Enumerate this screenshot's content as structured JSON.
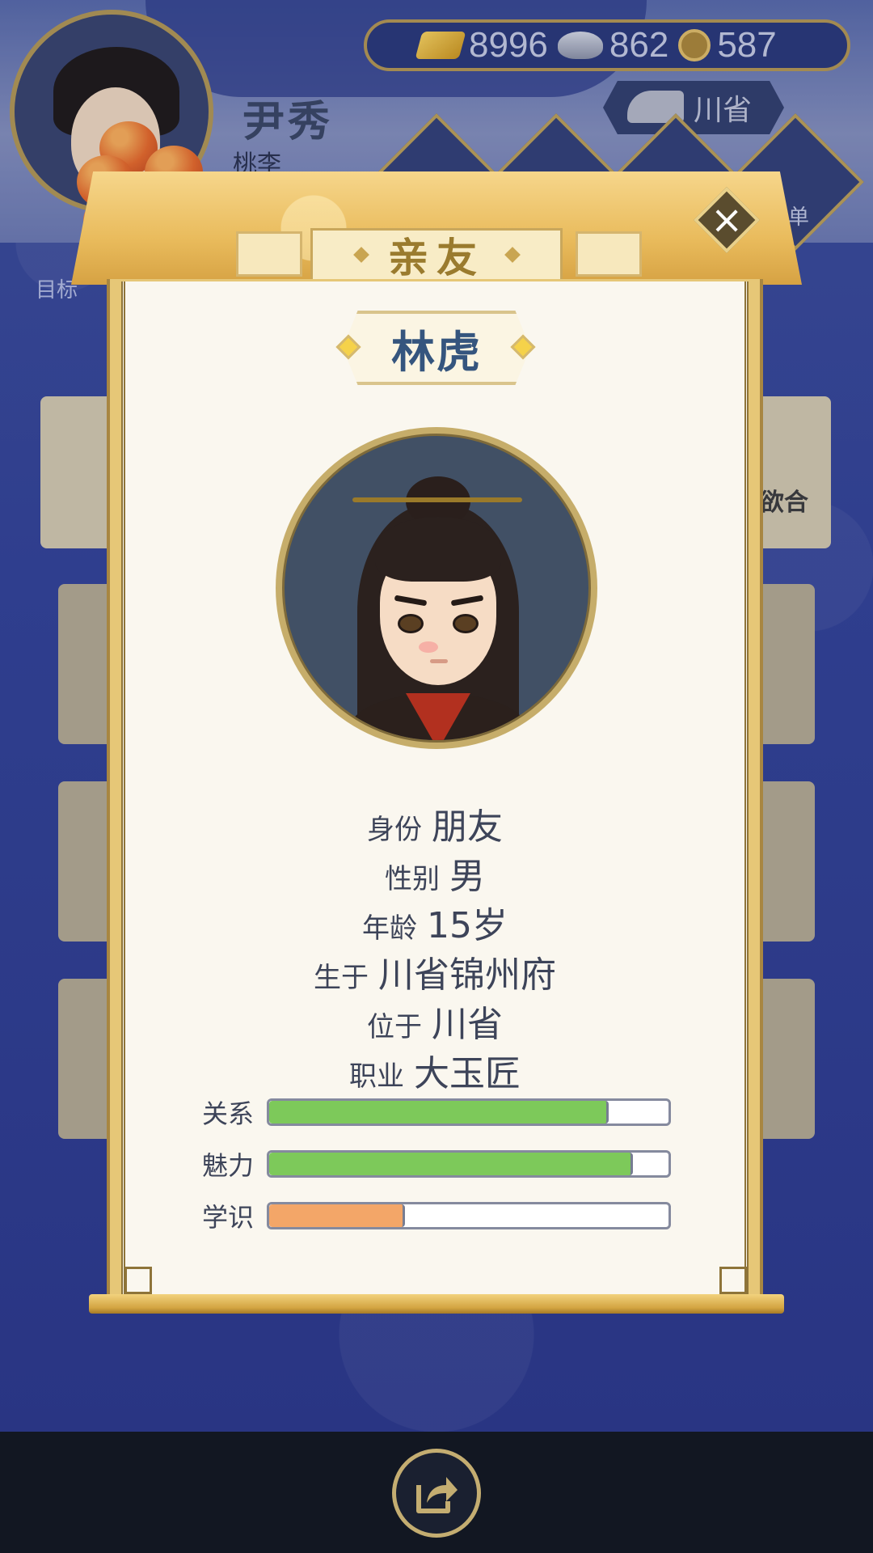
{
  "player": {
    "name": "尹秀",
    "sub": "桃李",
    "target_label": "目标"
  },
  "resources": [
    {
      "icon": "gold-ingot-icon",
      "value": "8996"
    },
    {
      "icon": "silver-ingot-icon",
      "value": "862"
    },
    {
      "icon": "copper-coin-icon",
      "value": "587"
    }
  ],
  "region": {
    "label": "川省"
  },
  "background_fragments": {
    "right_list": "单",
    "right_card": "欲合"
  },
  "modal": {
    "title": "亲友",
    "character": {
      "name": "林虎",
      "info": [
        {
          "label": "身份",
          "value": "朋友"
        },
        {
          "label": "性别",
          "value": "男"
        },
        {
          "label": "年龄",
          "value": "15岁"
        },
        {
          "label": "生于",
          "value": "川省锦州府"
        },
        {
          "label": "位于",
          "value": "川省"
        },
        {
          "label": "职业",
          "value": "大玉匠"
        }
      ],
      "stats": [
        {
          "label": "关系",
          "fraction": 0.85,
          "color": "#7dc95a"
        },
        {
          "label": "魅力",
          "fraction": 0.91,
          "color": "#7dc95a"
        },
        {
          "label": "学识",
          "fraction": 0.34,
          "color": "#f3a668"
        }
      ]
    }
  },
  "colors": {
    "background": "#2c3a86",
    "paper": "#faf7ef",
    "gold_trim": "#e9bb5c",
    "name_text": "#35557e",
    "bottom_bar": "#121722"
  }
}
